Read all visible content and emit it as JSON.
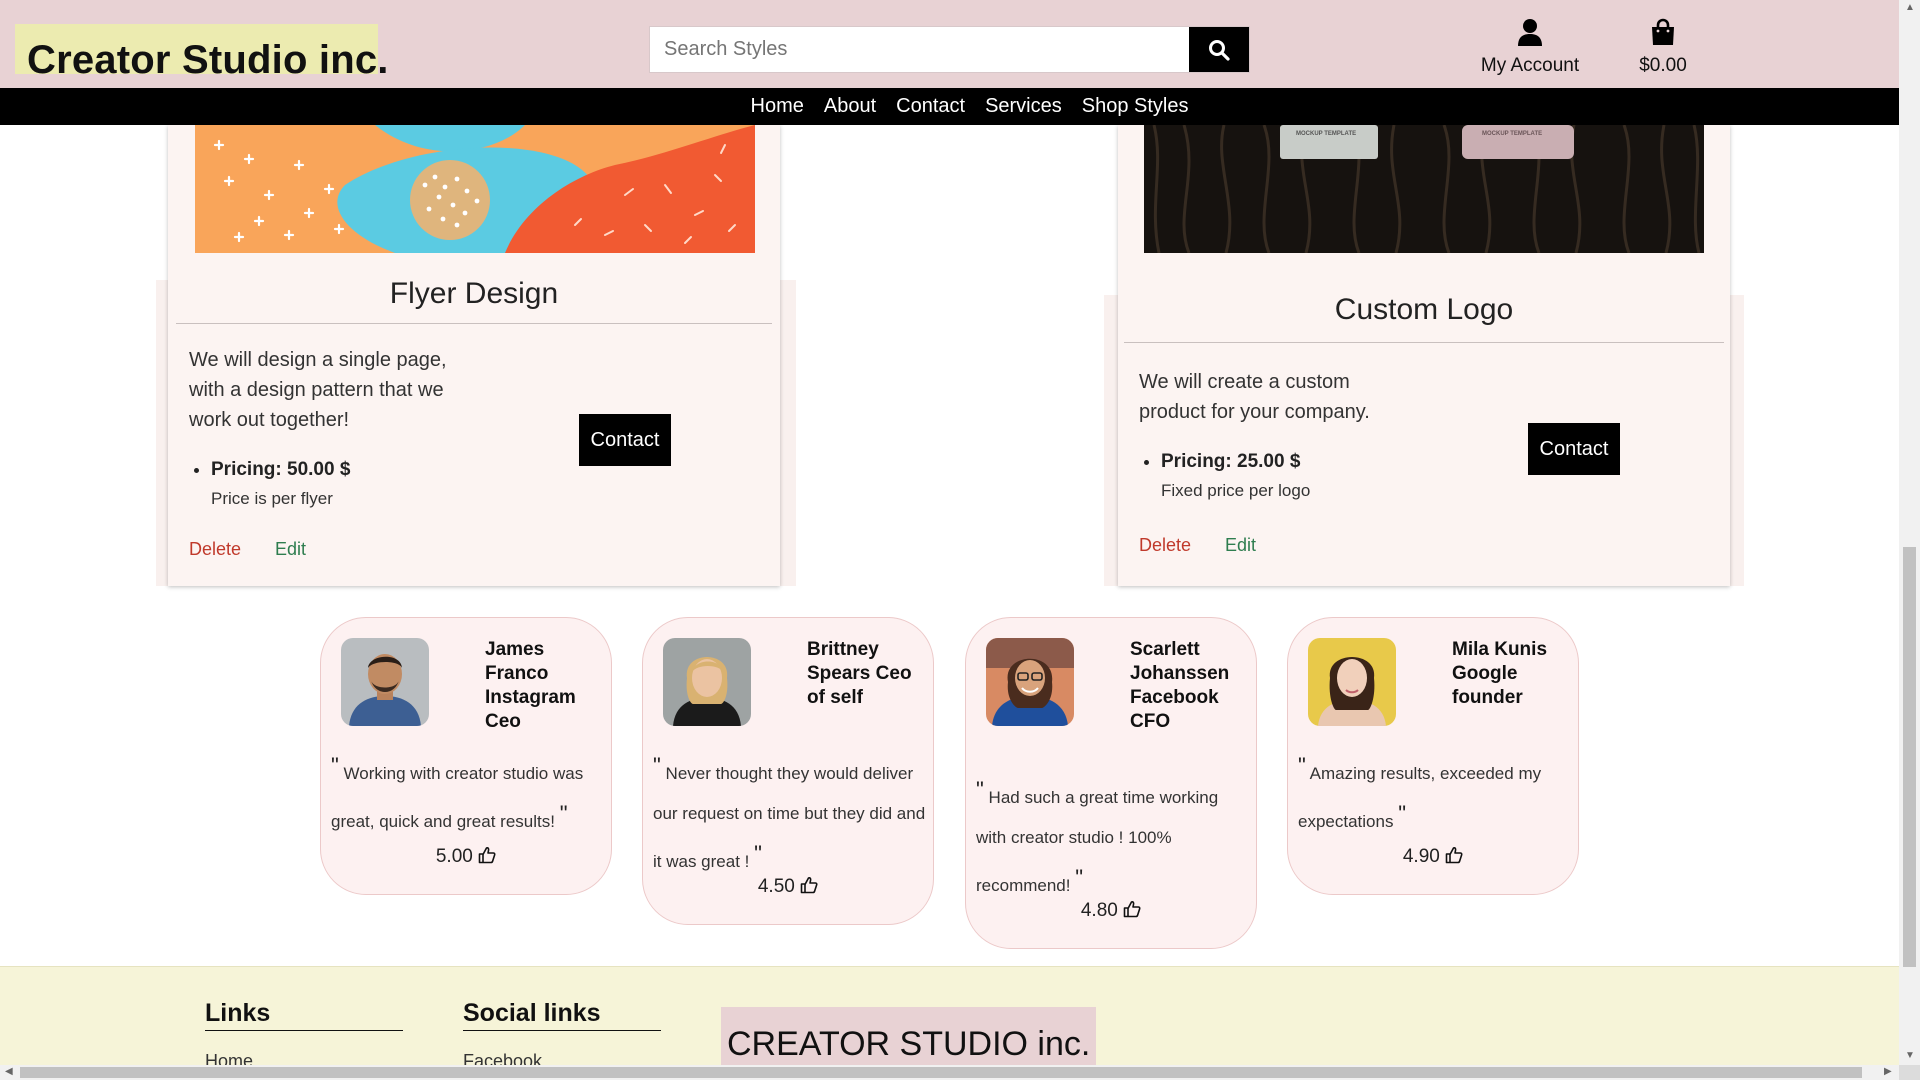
{
  "header": {
    "brand": "Creator Studio inc.",
    "search_placeholder": "Search Styles",
    "account_label": "My Account",
    "cart_total": "$0.00"
  },
  "nav": [
    "Home",
    "About",
    "Contact",
    "Services",
    "Shop Styles"
  ],
  "services": [
    {
      "title": "Flyer Design",
      "description": "We will design a single page, with a design pattern that we work out together!",
      "pricing": "Pricing: 50.00 $",
      "price_note": "Price is per flyer",
      "contact_label": "Contact",
      "delete_label": "Delete",
      "edit_label": "Edit"
    },
    {
      "title": "Custom Logo",
      "description": "We will create a custom product for your company.",
      "pricing": "Pricing: 25.00 $",
      "price_note": "Fixed price per logo",
      "contact_label": "Contact",
      "delete_label": "Delete",
      "edit_label": "Edit"
    }
  ],
  "testimonials": [
    {
      "name": "James Franco Instagram Ceo",
      "quote": "Working with creator studio was great, quick and great results!",
      "rating": "5.00"
    },
    {
      "name": "Brittney Spears Ceo of self",
      "quote": "Never thought they would deliver our request on time but they did and it was great !",
      "rating": "4.50"
    },
    {
      "name": "Scarlett Johanssen Facebook CFO",
      "quote": "Had such a great time working with creator studio ! 100% recommend!",
      "rating": "4.80"
    },
    {
      "name": "Mila Kunis Google founder",
      "quote": "Amazing results, exceeded my expectations",
      "rating": "4.90"
    }
  ],
  "footer": {
    "links_heading": "Links",
    "links_first": "Home",
    "social_heading": "Social links",
    "social_first": "Facebook",
    "brand": "CREATOR STUDIO inc."
  },
  "colors": {
    "header_bg": "#e8d2d4",
    "brand_bg": "#ecebb0",
    "nav_bg": "#000000",
    "card_bg": "#fcf4f2",
    "delete": "#c0392b",
    "edit": "#2e7d4f",
    "footer_bg": "#f6f4d8"
  },
  "mockup_template_labels": [
    "MOCKUP TEMPLATE",
    "MOCKUP TEMPLATE"
  ],
  "icons": [
    "search-icon",
    "user-icon",
    "shopping-bag-icon",
    "thumbs-up-icon"
  ]
}
